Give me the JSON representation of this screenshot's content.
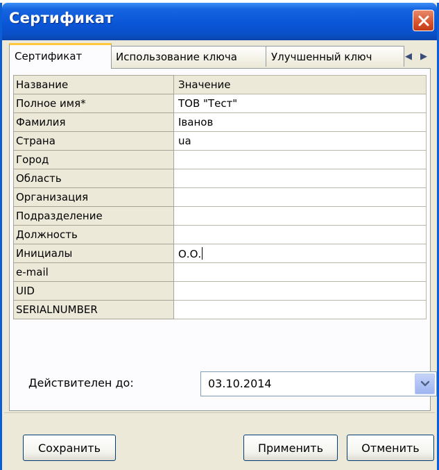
{
  "window": {
    "title": "Сертификат"
  },
  "tabs": [
    {
      "label": "Сертификат",
      "active": true
    },
    {
      "label": "Использование ключа",
      "active": false
    },
    {
      "label": "Улучшенный ключ",
      "active": false
    }
  ],
  "grid": {
    "header": {
      "name": "Название",
      "value": "Значение"
    },
    "rows": [
      {
        "name": "Полное имя*",
        "value": "ТОВ \"Тест\""
      },
      {
        "name": "Фамилия",
        "value": "Іванов"
      },
      {
        "name": "Страна",
        "value": "ua"
      },
      {
        "name": "Город",
        "value": ""
      },
      {
        "name": "Область",
        "value": ""
      },
      {
        "name": "Организация",
        "value": ""
      },
      {
        "name": "Подразделение",
        "value": ""
      },
      {
        "name": "Должность",
        "value": ""
      },
      {
        "name": "Инициалы",
        "value": "О.О."
      },
      {
        "name": "e-mail",
        "value": ""
      },
      {
        "name": "UID",
        "value": ""
      },
      {
        "name": "SERIALNUMBER",
        "value": ""
      }
    ]
  },
  "valid_until": {
    "label": "Действителен до:",
    "value": "03.10.2014"
  },
  "buttons": {
    "save": "Сохранить",
    "apply": "Применить",
    "cancel": "Отменить"
  },
  "colors": {
    "title_bar": "#0a56d8",
    "close": "#d9532d",
    "active_tab_accent": "#ffc83c"
  }
}
